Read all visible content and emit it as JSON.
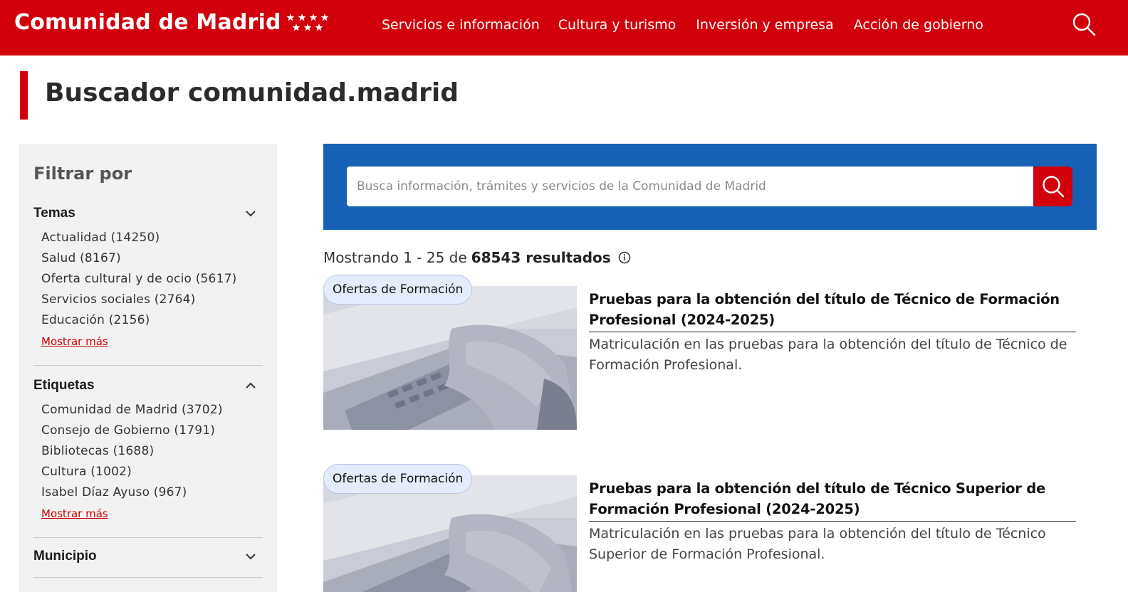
{
  "header": {
    "brand": "Comunidad de Madrid",
    "nav": [
      {
        "label": "Servicios e información"
      },
      {
        "label": "Cultura y turismo"
      },
      {
        "label": "Inversión y empresa"
      },
      {
        "label": "Acción de gobierno"
      }
    ]
  },
  "page": {
    "title": "Buscador comunidad.madrid"
  },
  "sidebar": {
    "title": "Filtrar por",
    "groups": [
      {
        "name": "Temas",
        "state": "collapsed",
        "items": [
          "Actualidad (14250)",
          "Salud (8167)",
          "Oferta cultural y de ocio (5617)",
          "Servicios sociales (2764)",
          "Educación (2156)"
        ],
        "show_more": "Mostrar más"
      },
      {
        "name": "Etiquetas",
        "state": "expanded",
        "items": [
          "Comunidad de Madrid (3702)",
          "Consejo de Gobierno (1791)",
          "Bibliotecas (1688)",
          "Cultura (1002)",
          "Isabel Díaz Ayuso (967)"
        ],
        "show_more": "Mostrar más"
      },
      {
        "name": "Municipio",
        "state": "collapsed",
        "items": []
      }
    ]
  },
  "search": {
    "placeholder": "Busca información, trámites y servicios de la Comunidad de Madrid",
    "value": ""
  },
  "results": {
    "prefix": "Mostrando 1 - 25 de",
    "total": "68543 resultados",
    "items": [
      {
        "badge": "Ofertas de Formación",
        "title": "Pruebas para la obtención del título de Técnico de Formación Profesional (2024-2025)",
        "description": "Matriculación en las pruebas para la obtención del título de Técnico de Formación Profesional."
      },
      {
        "badge": "Ofertas de Formación",
        "title": "Pruebas para la obtención del título de Técnico Superior de Formación Profesional (2024-2025)",
        "description": "Matriculación en las pruebas para la obtención del título de Técnico Superior de Formación Profesional."
      }
    ]
  },
  "colors": {
    "brand_red": "#d2000b",
    "search_blue": "#1661b5",
    "sidebar_bg": "#f2f2f2",
    "badge_bg": "#e4ebfa"
  },
  "icons": {
    "stars": "seven-stars-icon",
    "header_search": "search-icon",
    "search_button": "search-icon",
    "info": "info-icon",
    "chevron_down": "chevron-down-icon",
    "chevron_up": "chevron-up-icon"
  }
}
